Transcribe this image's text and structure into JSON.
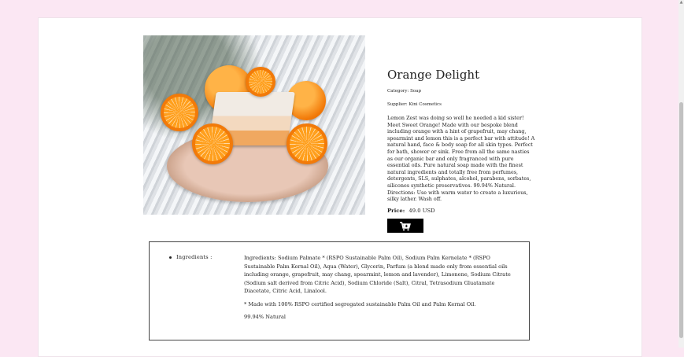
{
  "product": {
    "title": "Orange Delight",
    "category": "Category: Soap",
    "supplier": "Supplier: Kini Cosmetics",
    "description": "Lemon Zest was doing so well he needed a kid sister! Meet Sweet Orange! Made with our bespoke blend including orange with a hint of grapefruit, may chang, spearmint and lemon this is a perfect bar with attitude! A natural hand, face & body soap for all skin types. Perfect for bath, shower or sink. Free from all the same nasties as our organic bar and only fragranced with pure essential oils. Pure natural soap made with the finest natural ingredients and totally free from perfumes, detergents, SLS, sulphates, alcohol, parabens, sorbates, silicones synthetic preservatives. 99.94% Natural. Directions: Use with warm water to create a luxurious, silky lather. Wash off.",
    "price_label": "Price:",
    "price_value": "49.0 USD",
    "cart_icon": "shopping-cart-plus-icon"
  },
  "ingredients": {
    "label": "Ingredients :",
    "paragraphs": [
      "Ingredients: Sodium Palmate * (RSPO Sustainable Palm Oil), Sodium Palm Kernelate * (RSPO Sustainable Palm Kernal Oil), Aqua (Water), Glycerin, Parfum (a blend made only from essential oils including orange, grapefruit, may chang, spearmint, lemon and lavender), Limonene, Sodium Citrate (Sodium salt derived from Citric Acid), Sodium Chloride (Salt), Citral, Tetrasodium Gluatamate Diacetate, Citric Acid, Linalool.",
      "* Made with 100% RSPO certified segregated sustainable Palm Oil and Palm Kernal Oil.",
      "99.94% Natural"
    ]
  },
  "colors": {
    "page_background": "#fbe7f3",
    "button_background": "#000000"
  }
}
